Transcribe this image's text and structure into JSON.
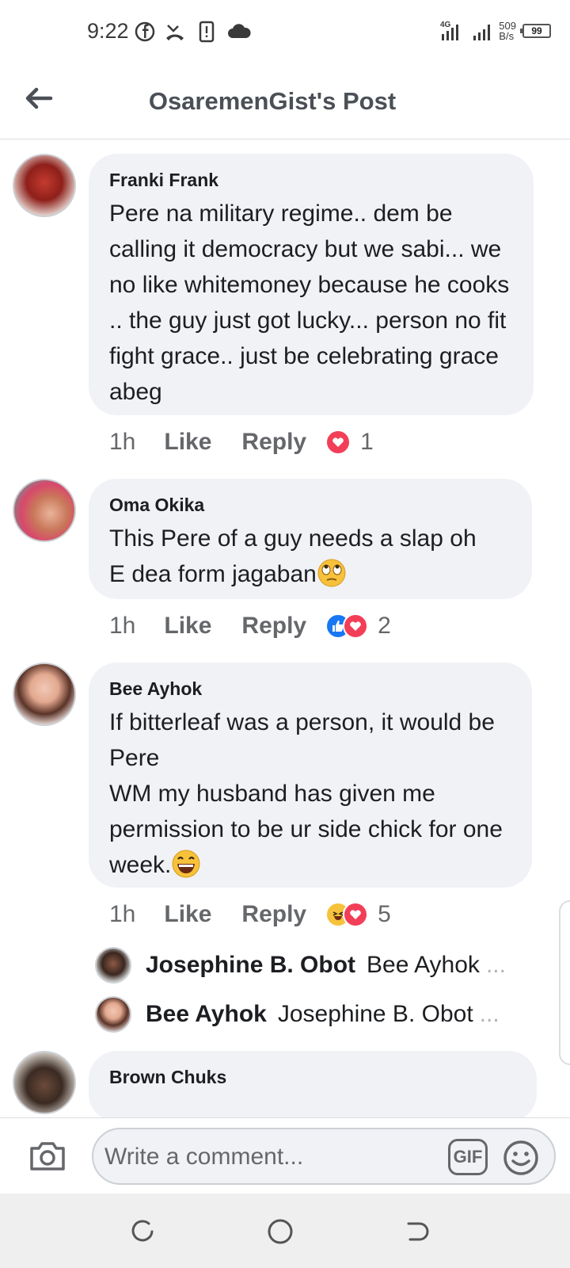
{
  "status_bar": {
    "time": "9:22",
    "network": "4G",
    "speed_value": "509",
    "speed_unit": "B/s",
    "battery": "99"
  },
  "header": {
    "title": "OsaremenGist's Post"
  },
  "comments": [
    {
      "name": "Franki Frank",
      "text": "Pere na military regime..  dem be calling it democracy but we sabi... we no like whitemoney because he cooks  .. the guy just got lucky... person no fit fight grace..  just be celebrating grace abeg",
      "time": "1h",
      "like_label": "Like",
      "reply_label": "Reply",
      "reaction_icons": [
        "heart-reaction-icon"
      ],
      "reaction_count": "1"
    },
    {
      "name": "Oma Okika",
      "text": "This Pere of a guy needs a slap oh\nE dea form jagaban",
      "emoji": "eye-roll-emoji-icon",
      "time": "1h",
      "like_label": "Like",
      "reply_label": "Reply",
      "reaction_icons": [
        "like-reaction-icon",
        "heart-reaction-icon"
      ],
      "reaction_count": "2"
    },
    {
      "name": "Bee Ayhok",
      "text": "If bitterleaf was a person, it would be Pere\nWM my husband has given me permission to be ur side chick for one week.",
      "emoji": "grinning-emoji-icon",
      "time": "1h",
      "like_label": "Like",
      "reply_label": "Reply",
      "reaction_icons": [
        "haha-reaction-icon",
        "heart-reaction-icon"
      ],
      "reaction_count": "5",
      "replies": [
        {
          "name": "Josephine B. Obot",
          "preview": "Bee Ayhok",
          "ellipsis": "..."
        },
        {
          "name": "Bee Ayhok",
          "preview": "Josephine B. Obot",
          "ellipsis": "..."
        }
      ]
    },
    {
      "name": "Brown Chuks"
    }
  ],
  "composer": {
    "placeholder": "Write a comment...",
    "gif_label": "GIF"
  },
  "colors": {
    "bubble_bg": "#f0f2f5",
    "meta_text": "#65676b",
    "heart": "#f33e58",
    "like": "#1877f2",
    "haha": "#f7c23b"
  }
}
